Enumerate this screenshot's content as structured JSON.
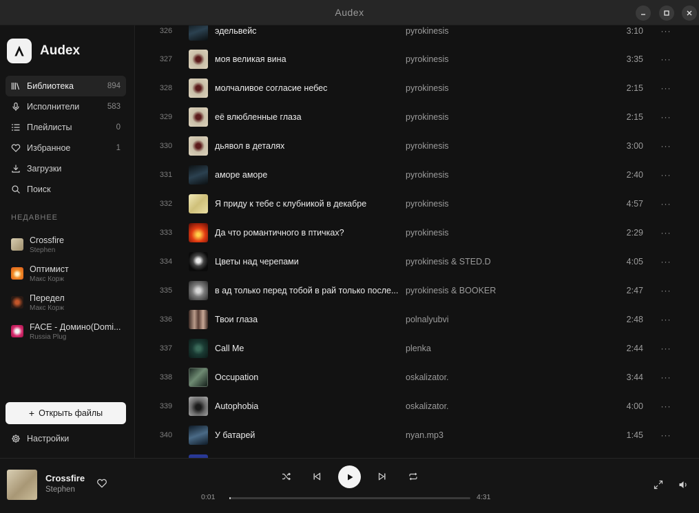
{
  "window": {
    "title": "Audex"
  },
  "sidebar": {
    "brand": "Audex",
    "nav": [
      {
        "label": "Библиотека",
        "count": "894",
        "icon": "library-icon",
        "active": true
      },
      {
        "label": "Исполнители",
        "count": "583",
        "icon": "microphone-icon",
        "active": false
      },
      {
        "label": "Плейлисты",
        "count": "0",
        "icon": "list-icon",
        "active": false
      },
      {
        "label": "Избранное",
        "count": "1",
        "icon": "heart-icon",
        "active": false
      },
      {
        "label": "Загрузки",
        "count": "",
        "icon": "download-icon",
        "active": false
      },
      {
        "label": "Поиск",
        "count": "",
        "icon": "search-icon",
        "active": false
      }
    ],
    "recent_heading": "НЕДАВНЕЕ",
    "recent": [
      {
        "title": "Crossfire",
        "artist": "Stephen"
      },
      {
        "title": "Оптимист",
        "artist": "Макс Корж"
      },
      {
        "title": "Передел",
        "artist": "Макс Корж"
      },
      {
        "title": "FACE - Домино(Domi...",
        "artist": "Russia Plug"
      }
    ],
    "open_files": "Открыть файлы",
    "settings": "Настройки"
  },
  "tracks": [
    {
      "num": "326",
      "title": "эдельвейс",
      "artist": "pyrokinesis",
      "duration": "3:10"
    },
    {
      "num": "327",
      "title": "моя великая вина",
      "artist": "pyrokinesis",
      "duration": "3:35"
    },
    {
      "num": "328",
      "title": "молчаливое согласие небес",
      "artist": "pyrokinesis",
      "duration": "2:15"
    },
    {
      "num": "329",
      "title": "её влюбленные глаза",
      "artist": "pyrokinesis",
      "duration": "2:15"
    },
    {
      "num": "330",
      "title": "дьявол в деталях",
      "artist": "pyrokinesis",
      "duration": "3:00"
    },
    {
      "num": "331",
      "title": "аморе аморе",
      "artist": "pyrokinesis",
      "duration": "2:40"
    },
    {
      "num": "332",
      "title": "Я приду к тебе с клубникой в декабре",
      "artist": "pyrokinesis",
      "duration": "4:57"
    },
    {
      "num": "333",
      "title": "Да что романтичного в птичках?",
      "artist": "pyrokinesis",
      "duration": "2:29"
    },
    {
      "num": "334",
      "title": "Цветы над черепами",
      "artist": "pyrokinesis & STED.D",
      "duration": "4:05"
    },
    {
      "num": "335",
      "title": "в ад только перед тобой в рай только после...",
      "artist": "pyrokinesis & BOOKER",
      "duration": "2:47"
    },
    {
      "num": "336",
      "title": "Твои глаза",
      "artist": "polnalyubvi",
      "duration": "2:48"
    },
    {
      "num": "337",
      "title": "Call Me",
      "artist": "plenka",
      "duration": "2:44"
    },
    {
      "num": "338",
      "title": "Occupation",
      "artist": "oskalizator.",
      "duration": "3:44"
    },
    {
      "num": "339",
      "title": "Autophobia",
      "artist": "oskalizator.",
      "duration": "4:00"
    },
    {
      "num": "340",
      "title": "У батарей",
      "artist": "nyan.mp3",
      "duration": "1:45"
    }
  ],
  "more_label": "···",
  "player": {
    "title": "Crossfire",
    "artist": "Stephen",
    "current_time": "0:01",
    "total_time": "4:31",
    "progress": 0.004
  }
}
